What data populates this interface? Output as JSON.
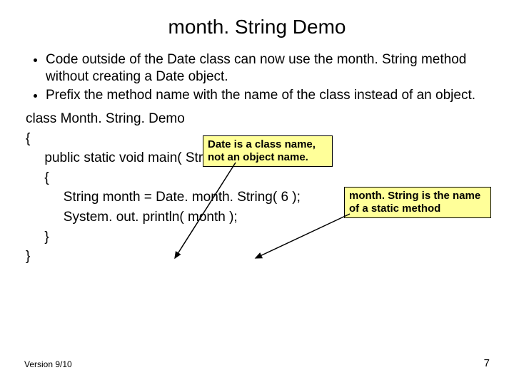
{
  "title": "month. String Demo",
  "bullets": [
    "Code outside of the Date class can now use the month. String method without creating a Date object.",
    "Prefix the method name with the name of the class instead of an object."
  ],
  "code": "class Month. String. Demo\n{\n     public static void main( String [ ] args )\n     {\n          String month = Date. month. String( 6 );\n          System. out. println( month );\n     }\n}",
  "callouts": {
    "c1": {
      "line1": "Date is a class name,",
      "line2": "not an object name."
    },
    "c2": {
      "line1": "month. String is the name",
      "line2": "of a static method"
    }
  },
  "footer": {
    "version": "Version 9/10",
    "page": "7"
  }
}
